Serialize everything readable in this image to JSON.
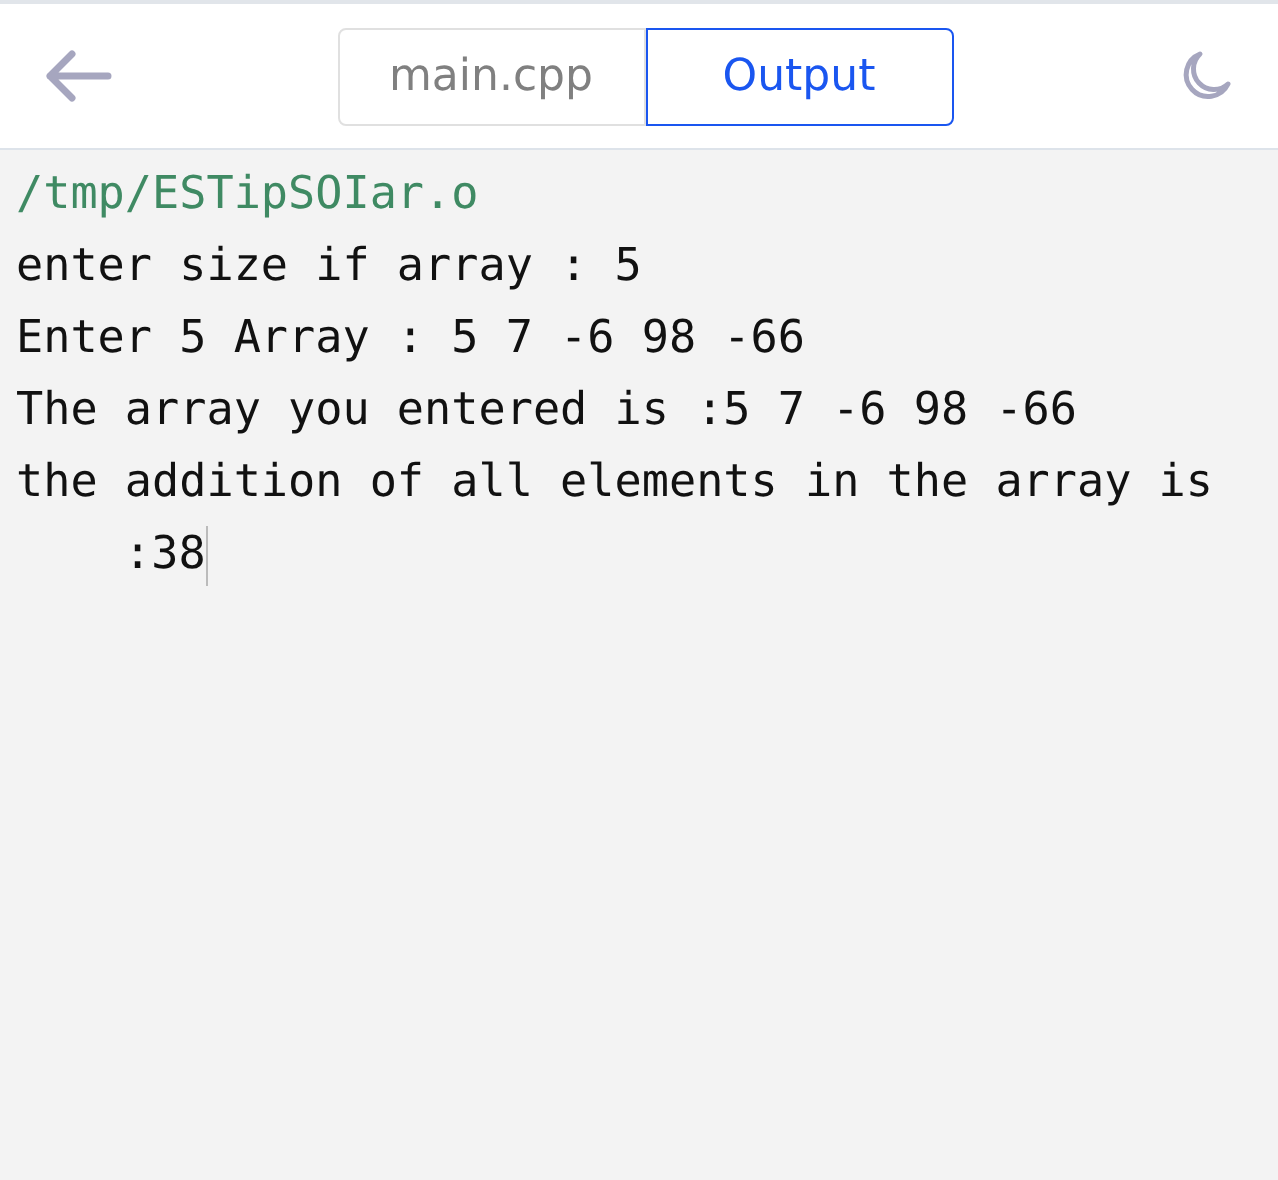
{
  "tabs": [
    {
      "label": "main.cpp",
      "selected": false
    },
    {
      "label": "Output",
      "selected": true
    }
  ],
  "output": [
    {
      "kind": "path",
      "text": "/tmp/ESTipSOIar.o"
    },
    {
      "kind": "text",
      "text": "enter size if array : 5"
    },
    {
      "kind": "text",
      "text": "Enter 5 Array : 5 7 -6 98 -66"
    },
    {
      "kind": "text",
      "text": "The array you entered is :5 7 -6 98 -66"
    },
    {
      "kind": "text",
      "text": "the addition of all elements in the array is :38"
    }
  ],
  "cursor": true
}
